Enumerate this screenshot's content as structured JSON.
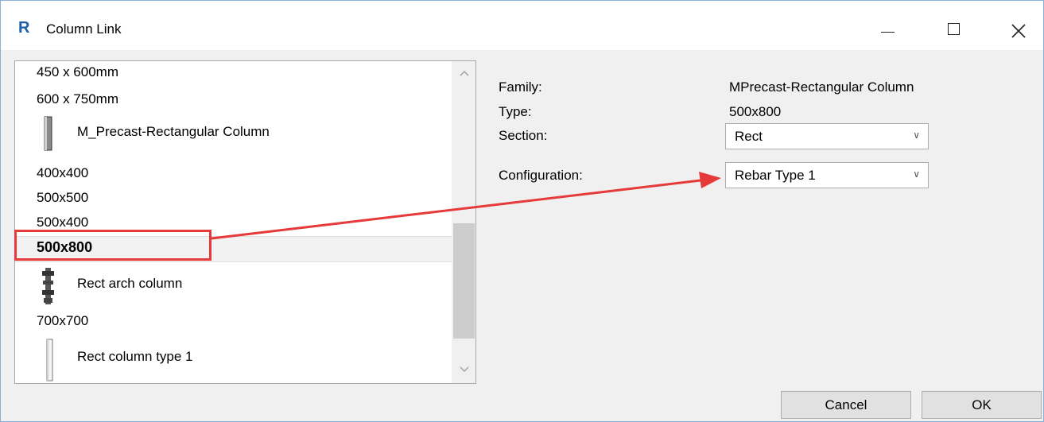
{
  "window": {
    "title": "Column Link",
    "app_icon_glyph": "R",
    "icons": {
      "app": "revit-app-icon",
      "minimize": "minimize-icon",
      "maximize": "maximize-icon",
      "close": "close-icon"
    }
  },
  "type_list": {
    "items_top": [
      "450 x 600mm",
      "600 x 750mm"
    ],
    "family1": {
      "label": "M_Precast-Rectangular Column",
      "icon": "rectangular-column-icon"
    },
    "family1_types": [
      "400x400",
      "500x500",
      "500x400"
    ],
    "selected": "500x800",
    "family2": {
      "label": "Rect arch column",
      "icon": "arch-column-icon"
    },
    "family2_types": [
      "700x700"
    ],
    "family3": {
      "label": "Rect column type 1",
      "icon": "column-icon"
    }
  },
  "properties": {
    "family_label": "Family:",
    "family_value": "MPrecast-Rectangular Column",
    "type_label": "Type:",
    "type_value": "500x800",
    "section_label": "Section:",
    "section_value": "Rect",
    "configuration_label": "Configuration:",
    "configuration_value": "Rebar Type 1"
  },
  "buttons": {
    "cancel": "Cancel",
    "ok": "OK"
  },
  "annotation": {
    "color": "#e63a3a"
  }
}
